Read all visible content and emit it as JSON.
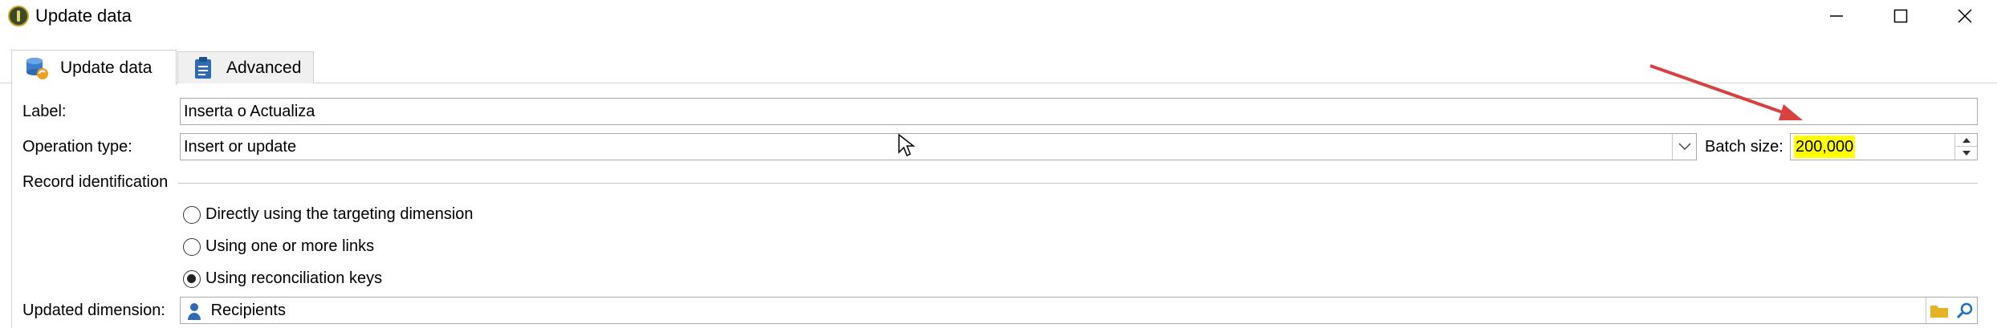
{
  "window": {
    "title": "Update data"
  },
  "tabs": [
    {
      "label": "Update data",
      "icon": "database-sync-icon",
      "active": true
    },
    {
      "label": "Advanced",
      "icon": "clipboard-icon",
      "active": false
    }
  ],
  "form": {
    "label": {
      "caption": "Label:",
      "value": "Inserta o Actualiza"
    },
    "operation_type": {
      "caption": "Operation type:",
      "value": "Insert or update"
    },
    "batch_size": {
      "caption": "Batch size:",
      "value": "200,000"
    },
    "record_identification": {
      "caption": "Record identification",
      "options": [
        {
          "label": "Directly using the targeting dimension",
          "checked": false
        },
        {
          "label": "Using one or more links",
          "checked": false
        },
        {
          "label": "Using reconciliation keys",
          "checked": true
        }
      ]
    },
    "updated_dimension": {
      "caption": "Updated dimension:",
      "value": "Recipients",
      "icon": "person-icon"
    }
  },
  "colors": {
    "highlight": "#ffff00",
    "annotation_arrow": "#d94040",
    "folder": "#e6b422",
    "search": "#1a6fc9"
  }
}
